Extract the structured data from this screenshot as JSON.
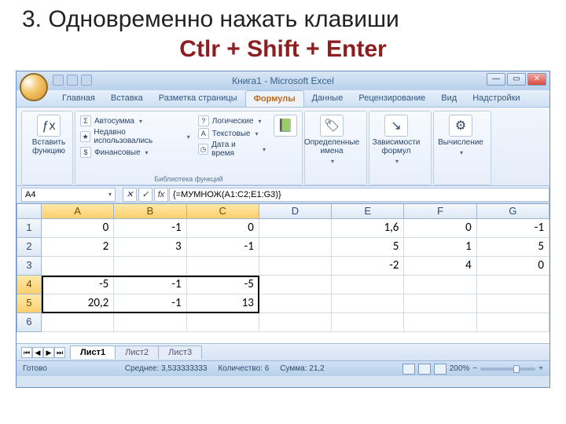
{
  "slide": {
    "line1": "3. Одновременно нажать клавиши",
    "line2": "Ctlr + Shift + Enter"
  },
  "window": {
    "title_doc": "Книга1",
    "title_app": "Microsoft Excel",
    "min": "—",
    "max": "▭",
    "close": "✕"
  },
  "tabs": [
    "Главная",
    "Вставка",
    "Разметка страницы",
    "Формулы",
    "Данные",
    "Рецензирование",
    "Вид",
    "Надстройки"
  ],
  "active_tab": "Формулы",
  "ribbon": {
    "insert_fn": "Вставить\nфункцию",
    "lib_group": "Библиотека функций",
    "autosum": "Автосумма",
    "recent": "Недавно использовались",
    "financial": "Финансовые",
    "logical": "Логические",
    "text": "Текстовые",
    "datetime": "Дата и время",
    "names": "Определенные\nимена",
    "deps": "Зависимости\nформул",
    "calc": "Вычисление"
  },
  "namebox": "A4",
  "formula": "{=МУМНОЖ(A1:C2;E1:G3)}",
  "columns": [
    "A",
    "B",
    "C",
    "D",
    "E",
    "F",
    "G"
  ],
  "sel_cols": [
    "A",
    "B",
    "C"
  ],
  "sel_rows": [
    "4",
    "5"
  ],
  "grid": {
    "1": {
      "A": "0",
      "B": "-1",
      "C": "0",
      "E": "1,6",
      "F": "0",
      "G": "-1"
    },
    "2": {
      "A": "2",
      "B": "3",
      "C": "-1",
      "E": "5",
      "F": "1",
      "G": "5"
    },
    "3": {
      "E": "-2",
      "F": "4",
      "G": "0"
    },
    "4": {
      "A": "-5",
      "B": "-1",
      "C": "-5"
    },
    "5": {
      "A": "20,2",
      "B": "-1",
      "C": "13"
    }
  },
  "sheets": {
    "active": "Лист1",
    "others": [
      "Лист2",
      "Лист3"
    ]
  },
  "status": {
    "ready": "Готово",
    "avg_label": "Среднее:",
    "avg_val": "3,533333333",
    "count_label": "Количество:",
    "count_val": "6",
    "sum_label": "Сумма:",
    "sum_val": "21,2",
    "zoom": "200%"
  }
}
